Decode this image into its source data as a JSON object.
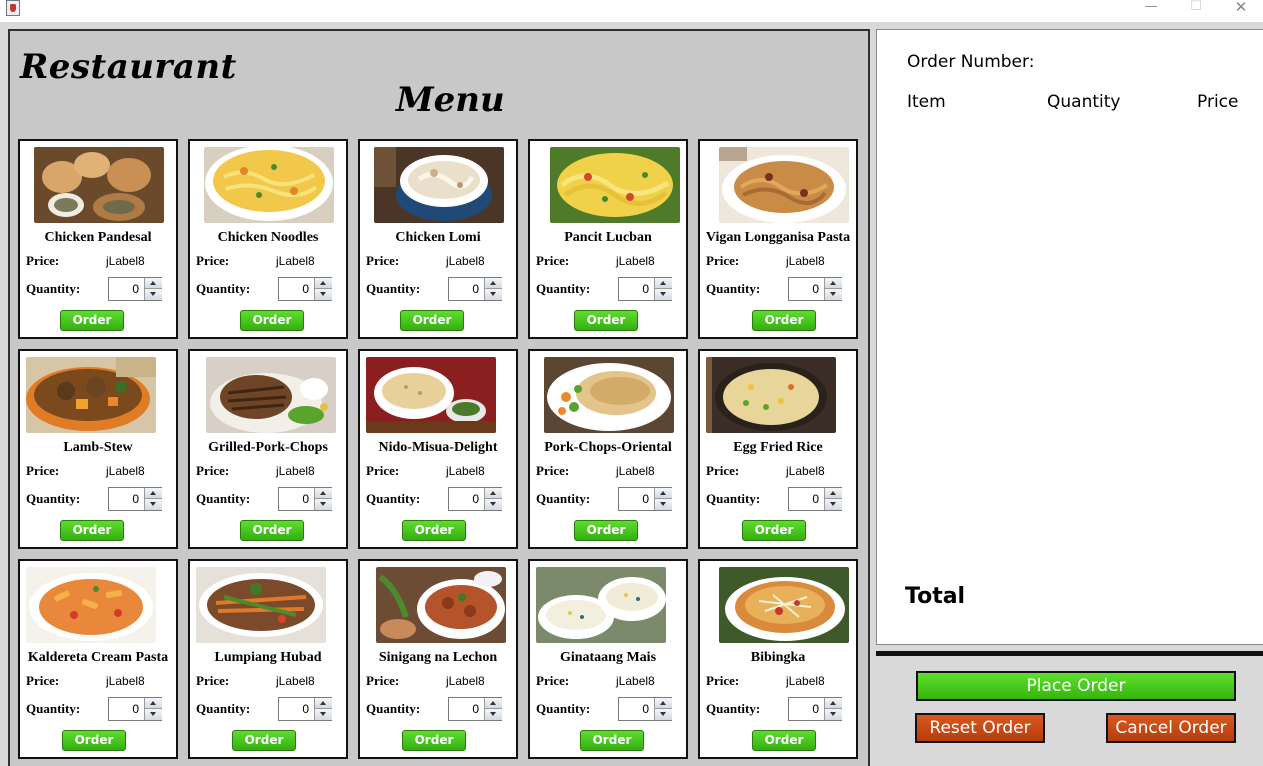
{
  "window": {
    "minimize_glyph": "—",
    "maximize_glyph": "☐",
    "close_glyph": "✕"
  },
  "menu": {
    "title_line1": "Restaurant",
    "title_line2": "Menu",
    "price_label": "Price:",
    "quantity_label": "Quantity:",
    "order_label": "Order",
    "items": [
      {
        "name": "Chicken Pandesal",
        "price": "jLabel8",
        "quantity": "0",
        "image": "bread-rolls-photo"
      },
      {
        "name": "Chicken Noodles",
        "price": "jLabel8",
        "quantity": "0",
        "image": "noodle-soup-photo"
      },
      {
        "name": "Chicken Lomi",
        "price": "jLabel8",
        "quantity": "0",
        "image": "lomi-bowl-photo"
      },
      {
        "name": "Pancit Lucban",
        "price": "jLabel8",
        "quantity": "0",
        "image": "pancit-photo"
      },
      {
        "name": "Vigan Longganisa Pasta",
        "price": "jLabel8",
        "quantity": "0",
        "image": "pasta-plate-photo"
      },
      {
        "name": "Lamb-Stew",
        "price": "jLabel8",
        "quantity": "0",
        "image": "stew-bowl-photo"
      },
      {
        "name": "Grilled-Pork-Chops",
        "price": "jLabel8",
        "quantity": "0",
        "image": "pork-chops-photo"
      },
      {
        "name": "Nido-Misua-Delight",
        "price": "jLabel8",
        "quantity": "0",
        "image": "misua-soup-photo"
      },
      {
        "name": "Pork-Chops-Oriental",
        "price": "jLabel8",
        "quantity": "0",
        "image": "oriental-pork-photo"
      },
      {
        "name": "Egg Fried Rice",
        "price": "jLabel8",
        "quantity": "0",
        "image": "fried-rice-photo"
      },
      {
        "name": "Kaldereta Cream Pasta",
        "price": "jLabel8",
        "quantity": "0",
        "image": "penne-pasta-photo"
      },
      {
        "name": "Lumpiang Hubad",
        "price": "jLabel8",
        "quantity": "0",
        "image": "lumpia-salad-photo"
      },
      {
        "name": "Sinigang na Lechon",
        "price": "jLabel8",
        "quantity": "0",
        "image": "sinigang-photo"
      },
      {
        "name": "Ginataang Mais",
        "price": "jLabel8",
        "quantity": "0",
        "image": "corn-soup-photo"
      },
      {
        "name": "Bibingka",
        "price": "jLabel8",
        "quantity": "0",
        "image": "bibingka-photo"
      }
    ]
  },
  "order_panel": {
    "order_number_label": "Order Number:",
    "columns": [
      "Item",
      "Quantity",
      "Price"
    ],
    "total_label": "Total"
  },
  "actions": {
    "place_order": "Place Order",
    "reset_order": "Reset Order",
    "cancel_order": "Cancel Order"
  },
  "colors": {
    "order_green": "#3cc012",
    "reset_orange": "#c8480f",
    "panel_gray": "#c8c8c8"
  }
}
